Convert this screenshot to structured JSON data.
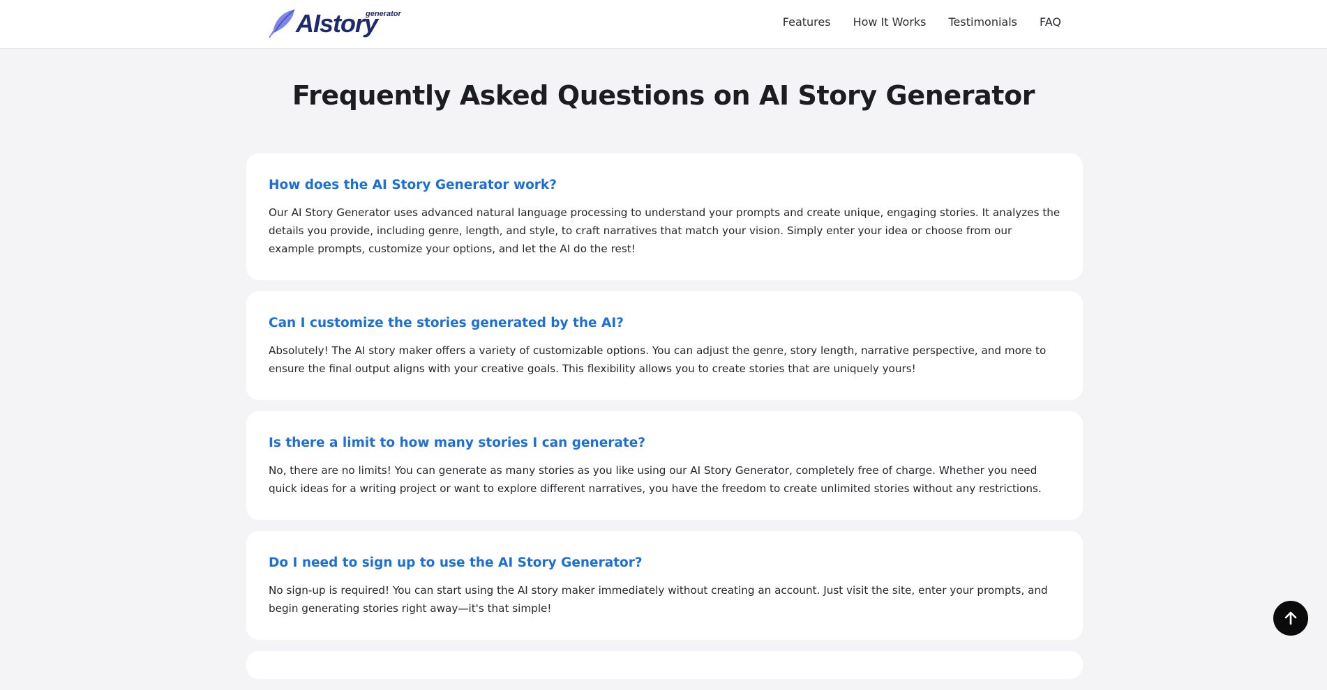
{
  "header": {
    "logo": {
      "word": "AIstory",
      "sub": "generator"
    },
    "nav": [
      {
        "label": "Features"
      },
      {
        "label": "How It Works"
      },
      {
        "label": "Testimonials"
      },
      {
        "label": "FAQ"
      }
    ]
  },
  "main": {
    "title": "Frequently Asked Questions on AI Story Generator",
    "faqs": [
      {
        "question": "How does the AI Story Generator work?",
        "answer": "Our AI Story Generator uses advanced natural language processing to understand your prompts and create unique, engaging stories. It analyzes the details you provide, including genre, length, and style, to craft narratives that match your vision. Simply enter your idea or choose from our example prompts, customize your options, and let the AI do the rest!"
      },
      {
        "question": "Can I customize the stories generated by the AI?",
        "answer": "Absolutely! The AI story maker offers a variety of customizable options. You can adjust the genre, story length, narrative perspective, and more to ensure the final output aligns with your creative goals. This flexibility allows you to create stories that are uniquely yours!"
      },
      {
        "question": "Is there a limit to how many stories I can generate?",
        "answer": "No, there are no limits! You can generate as many stories as you like using our AI Story Generator, completely free of charge. Whether you need quick ideas for a writing project or want to explore different narratives, you have the freedom to create unlimited stories without any restrictions."
      },
      {
        "question": "Do I need to sign up to use the AI Story Generator?",
        "answer": "No sign-up is required! You can start using the AI story maker immediately without creating an account. Just visit the site, enter your prompts, and begin generating stories right away—it's that simple!"
      }
    ]
  },
  "scroll_top": {
    "icon": "arrow-up-icon"
  },
  "colors": {
    "accent": "#1a6fd8",
    "background": "#f4f4f6",
    "card": "#ffffff",
    "logo": "#1e2a6e"
  }
}
